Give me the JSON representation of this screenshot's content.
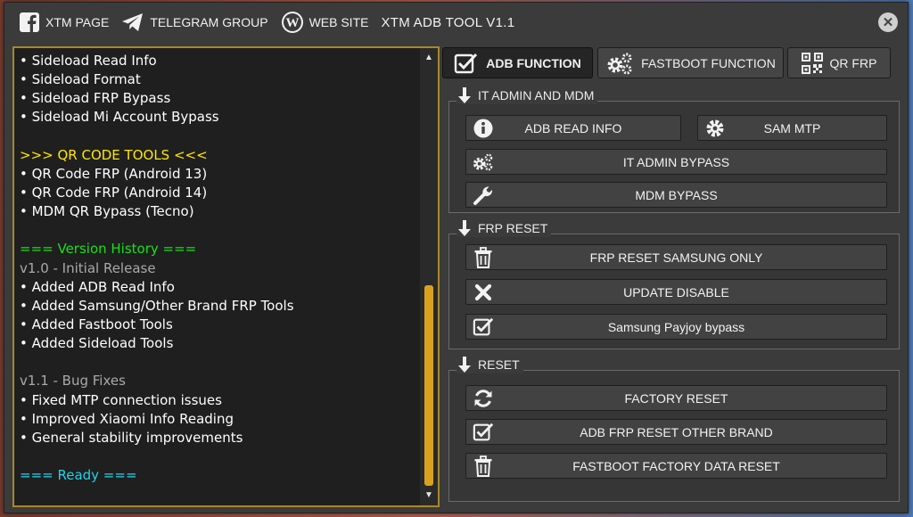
{
  "titlebar": {
    "xtm_page": "XTM PAGE",
    "telegram_group": "TELEGRAM GROUP",
    "web_site": "WEB SITE",
    "app_title": "XTM ADB TOOL V1.1",
    "close": "✕"
  },
  "log": {
    "lines": [
      {
        "text": "• Sideload Read Info",
        "color": "#ffffff"
      },
      {
        "text": "• Sideload Format",
        "color": "#ffffff"
      },
      {
        "text": "• Sideload FRP Bypass",
        "color": "#ffffff"
      },
      {
        "text": "• Sideload Mi Account Bypass",
        "color": "#ffffff"
      },
      {
        "text": "",
        "color": "#ffffff"
      },
      {
        "text": ">>> QR CODE TOOLS <<<",
        "color": "#ffe600"
      },
      {
        "text": "• QR Code FRP (Android 13)",
        "color": "#ffffff"
      },
      {
        "text": "• QR Code FRP (Android 14)",
        "color": "#ffffff"
      },
      {
        "text": "• MDM QR Bypass (Tecno)",
        "color": "#ffffff"
      },
      {
        "text": "",
        "color": "#ffffff"
      },
      {
        "text": "=== Version History ===",
        "color": "#18e018"
      },
      {
        "text": "v1.0 - Initial Release",
        "color": "#a9a9a9"
      },
      {
        "text": "• Added ADB Read Info",
        "color": "#ffffff"
      },
      {
        "text": "• Added Samsung/Other Brand FRP Tools",
        "color": "#ffffff"
      },
      {
        "text": "• Added Fastboot Tools",
        "color": "#ffffff"
      },
      {
        "text": "• Added Sideload Tools",
        "color": "#ffffff"
      },
      {
        "text": "",
        "color": "#ffffff"
      },
      {
        "text": "v1.1 - Bug Fixes",
        "color": "#a9a9a9"
      },
      {
        "text": "• Fixed MTP connection issues",
        "color": "#ffffff"
      },
      {
        "text": "• Improved Xiaomi Info Reading",
        "color": "#ffffff"
      },
      {
        "text": "• General stability improvements",
        "color": "#ffffff"
      },
      {
        "text": "",
        "color": "#ffffff"
      },
      {
        "text": "=== Ready ===",
        "color": "#22d3e8"
      }
    ],
    "scroll": {
      "thumb_start_fraction": 0.52,
      "thumb_end_fraction": 1.0,
      "thumb_color": "#d9a21e"
    }
  },
  "tabs": {
    "adb": "ADB FUNCTION",
    "fastboot": "FASTBOOT FUNCTION",
    "qr": "QR FRP"
  },
  "groups": {
    "it_admin": {
      "label": "IT ADMIN AND MDM",
      "adb_read_info": "ADB READ INFO",
      "sam_mtp": "SAM MTP",
      "it_admin_bypass": "IT ADMIN BYPASS",
      "mdm_bypass": "MDM BYPASS"
    },
    "frp_reset": {
      "label": "FRP RESET",
      "frp_reset_samsung": "FRP RESET SAMSUNG ONLY",
      "update_disable": "UPDATE DISABLE",
      "samsung_payjoy": "Samsung Payjoy bypass"
    },
    "reset": {
      "label": "RESET",
      "factory_reset": "FACTORY RESET",
      "adb_frp_other": "ADB FRP RESET OTHER BRAND",
      "fastboot_factory": "FASTBOOT FACTORY DATA RESET"
    }
  },
  "colors": {
    "accent_border": "#a8882a",
    "panel_bg": "#1f1f1f",
    "window_bg": "#3b3b3b"
  }
}
